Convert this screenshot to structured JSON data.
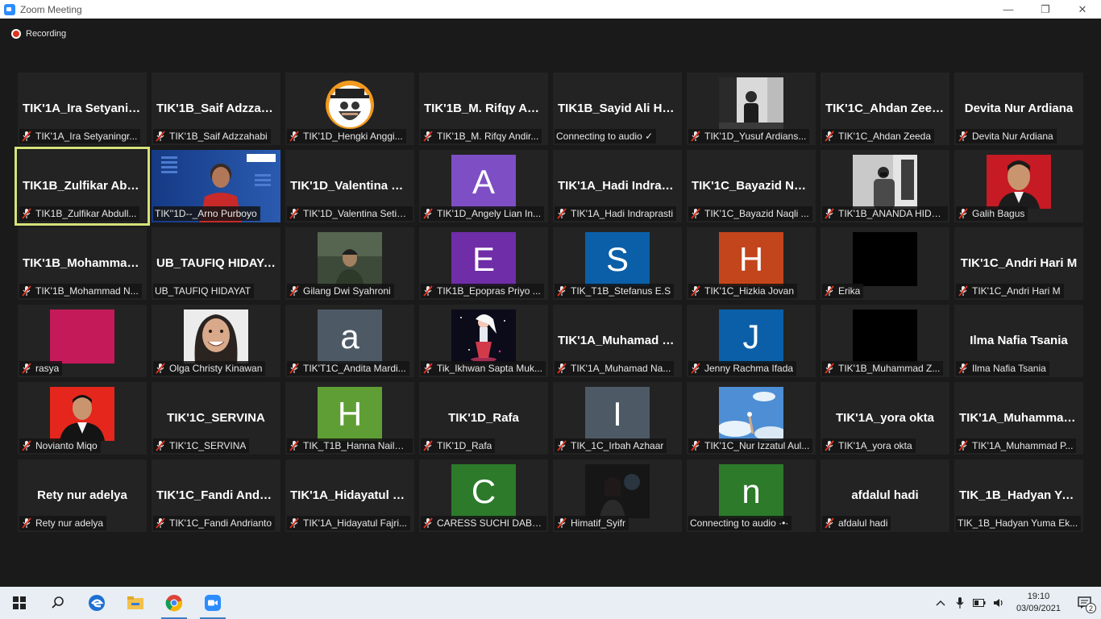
{
  "window": {
    "title": "Zoom Meeting",
    "minimize": "—",
    "restore": "❐",
    "close": "✕"
  },
  "recording": {
    "label": "Recording"
  },
  "tiles": [
    {
      "big": "TIK'1A_Ira Setyaning...",
      "label": "TIK'1A_Ira Setyaningr...",
      "muted": true
    },
    {
      "big": "TIK'1B_Saif Adzzah...",
      "label": "TIK'1B_Saif Adzzahabi",
      "muted": true
    },
    {
      "photo": "cartoon-avatar",
      "label": "TIK'1D_Hengki Anggi...",
      "muted": true
    },
    {
      "big": "TIK'1B_M. Rifqy And...",
      "label": "TIK'1B_M. Rifqy Andir...",
      "muted": true
    },
    {
      "big": "TIK1B_Sayid Ali Hu...",
      "label": "Connecting to audio ✓",
      "muted": false
    },
    {
      "photo": "person-outdoor",
      "label": "TIK'1D_Yusuf Ardians...",
      "muted": true
    },
    {
      "big": "TIK'1C_Ahdan Zeeda",
      "label": "TIK'1C_Ahdan Zeeda",
      "muted": true
    },
    {
      "big": "Devita Nur Ardiana",
      "label": "Devita Nur Ardiana",
      "muted": true
    },
    {
      "big": "TIK1B_Zulfikar Abdu...",
      "label": "TIK1B_Zulfikar Abdull...",
      "muted": true,
      "active": true
    },
    {
      "photo": "video-blue",
      "label": "TIK''1D--_Arno Purboyo",
      "muted": false
    },
    {
      "big": "TIK'1D_Valentina Set...",
      "label": "TIK'1D_Valentina Setia...",
      "muted": true
    },
    {
      "letter": "A",
      "color": "#7e4fc4",
      "label": "TIK'1D_Angely Lian In...",
      "muted": true
    },
    {
      "big": "TIK'1A_Hadi Indrapras...",
      "label": "TIK'1A_Hadi Indraprasti",
      "muted": true
    },
    {
      "big": "TIK'1C_Bayazid Naqli",
      "label": "TIK'1C_Bayazid Naqli ...",
      "muted": true
    },
    {
      "photo": "person-gray",
      "label": "TIK'1B_ANANDA HIDA...",
      "muted": true
    },
    {
      "photo": "portrait-red",
      "label": "Galih Bagus",
      "muted": true
    },
    {
      "big": "TIK'1B_Mohammad N...",
      "label": "TIK'1B_Mohammad N...",
      "muted": true
    },
    {
      "big": "UB_TAUFIQ HIDAYAT",
      "label": "UB_TAUFIQ HIDAYAT",
      "muted": false
    },
    {
      "photo": "person-green",
      "label": "Gilang Dwi Syahroni",
      "muted": true
    },
    {
      "letter": "E",
      "color": "#6f2da8",
      "label": "TIK1B_Epopras Priyo ...",
      "muted": true
    },
    {
      "letter": "S",
      "color": "#0a5fa8",
      "label": "TIK_T1B_Stefanus E.S",
      "muted": true
    },
    {
      "letter": "H",
      "color": "#c3451b",
      "label": "TIK'1C_Hizkia Jovan",
      "muted": true
    },
    {
      "photo": "black",
      "label": "Erika",
      "muted": true
    },
    {
      "big": "TIK'1C_Andri Hari M",
      "label": "TIK'1C_Andri Hari M",
      "muted": true
    },
    {
      "photo": "solid-magenta",
      "label": "rasya",
      "muted": true
    },
    {
      "photo": "smiling-woman",
      "label": "Olga Christy Kinawan",
      "muted": true
    },
    {
      "letter": "a",
      "color": "#4d5a66",
      "label": "TIK'T1C_Andita Mardi...",
      "muted": true
    },
    {
      "photo": "anime-figure",
      "label": "Tik_Ikhwan Sapta Muk...",
      "muted": true
    },
    {
      "big": "TIK'1A_Muhamad Nas...",
      "label": "TIK'1A_Muhamad Na...",
      "muted": true
    },
    {
      "letter": "J",
      "color": "#0a5fa8",
      "label": "Jenny Rachma Ifada",
      "muted": true
    },
    {
      "photo": "black",
      "label": "TIK'1B_Muhammad Z...",
      "muted": true
    },
    {
      "big": "Ilma Nafia Tsania",
      "label": "Ilma Nafia Tsania",
      "muted": true
    },
    {
      "photo": "portrait-red-shirt",
      "label": "Novianto Miqo",
      "muted": true
    },
    {
      "big": "TIK'1C_SERVINA",
      "label": "TIK'1C_SERVINA",
      "muted": true
    },
    {
      "letter": "H",
      "color": "#5f9e35",
      "label": "TIK_T1B_Hanna Naila ...",
      "muted": true
    },
    {
      "big": "TIK'1D_Rafa",
      "label": "TIK'1D_Rafa",
      "muted": true
    },
    {
      "letter": "I",
      "color": "#4d5a66",
      "label": "TIK_1C_Irbah Azhaar",
      "muted": true
    },
    {
      "photo": "sky-flower",
      "label": "TIK'1C_Nur Izzatul Aul...",
      "muted": true
    },
    {
      "big": "TIK'1A_yora okta",
      "label": "TIK'1A_yora okta",
      "muted": true
    },
    {
      "big": "TIK'1A_Muhammad P...",
      "label": "TIK'1A_Muhammad P...",
      "muted": true
    },
    {
      "big": "Rety nur adelya",
      "label": "Rety nur adelya",
      "muted": true
    },
    {
      "big": "TIK'1C_Fandi Andrian...",
      "label": "TIK'1C_Fandi Andrianto",
      "muted": true
    },
    {
      "big": "TIK'1A_Hidayatul Fajri...",
      "label": "TIK'1A_Hidayatul Fajri...",
      "muted": true
    },
    {
      "letter": "C",
      "color": "#2d7a2a",
      "label": "CARESS SUCHI DABRI...",
      "muted": true
    },
    {
      "photo": "dark-person",
      "label": "Himatif_Syifr",
      "muted": true
    },
    {
      "letter": "n",
      "color": "#2d7a2a",
      "label": "Connecting to audio ·•·",
      "muted": false
    },
    {
      "big": "afdalul hadi",
      "label": "afdalul hadi",
      "muted": true
    },
    {
      "big": "TIK_1B_Hadyan Yuma...",
      "label": "TIK_1B_Hadyan Yuma Ek...",
      "muted": false
    }
  ],
  "taskbar": {
    "apps": [
      "start-icon",
      "search-icon",
      "edge-icon",
      "file-explorer-icon",
      "chrome-icon",
      "zoom-icon"
    ],
    "time": "19:10",
    "date": "03/09/2021",
    "notifications": "2"
  }
}
